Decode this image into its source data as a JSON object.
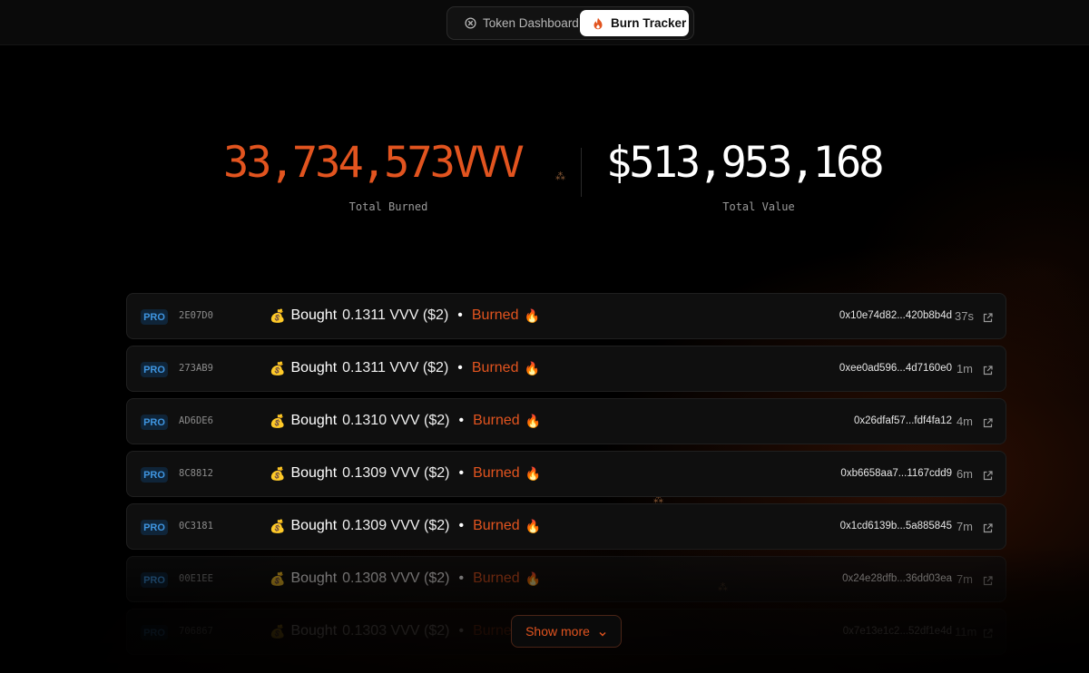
{
  "nav": {
    "tabs": [
      {
        "label": "Token Dashboard",
        "icon": "x-circle-icon",
        "active": false
      },
      {
        "label": "Burn Tracker",
        "icon": "flame-icon",
        "active": true
      }
    ]
  },
  "stats": {
    "total_burned": "33,734,573VVV",
    "total_burned_label": "Total Burned",
    "total_value": "$513,953,168",
    "total_value_label": "Total Value"
  },
  "colors": {
    "accent": "#e2541f",
    "badge": "#3f95e0",
    "background": "#000000"
  },
  "feed": {
    "rows": [
      {
        "badge": "PRO",
        "id": "2E07D0",
        "verb": "Bought",
        "amount": "0.1311 VVV ($2)",
        "status": "Burned",
        "hash": "0x10e74d82...420b8b4d",
        "age": "37s"
      },
      {
        "badge": "PRO",
        "id": "273AB9",
        "verb": "Bought",
        "amount": "0.1311 VVV ($2)",
        "status": "Burned",
        "hash": "0xee0ad596...4d7160e0",
        "age": "1m"
      },
      {
        "badge": "PRO",
        "id": "AD6DE6",
        "verb": "Bought",
        "amount": "0.1310 VVV ($2)",
        "status": "Burned",
        "hash": "0x26dfaf57...fdf4fa12",
        "age": "4m"
      },
      {
        "badge": "PRO",
        "id": "8C8812",
        "verb": "Bought",
        "amount": "0.1309 VVV ($2)",
        "status": "Burned",
        "hash": "0xb6658aa7...1167cdd9",
        "age": "6m"
      },
      {
        "badge": "PRO",
        "id": "0C3181",
        "verb": "Bought",
        "amount": "0.1309 VVV ($2)",
        "status": "Burned",
        "hash": "0x1cd6139b...5a885845",
        "age": "7m"
      },
      {
        "badge": "PRO",
        "id": "00E1EE",
        "verb": "Bought",
        "amount": "0.1308 VVV ($2)",
        "status": "Burned",
        "hash": "0x24e28dfb...36dd03ea",
        "age": "7m"
      },
      {
        "badge": "PRO",
        "id": "706867",
        "verb": "Bought",
        "amount": "0.1303 VVV ($2)",
        "status": "Burned",
        "hash": "0x7e13e1c2...52df1e4d",
        "age": "11m"
      }
    ]
  },
  "show_more_label": "Show more"
}
